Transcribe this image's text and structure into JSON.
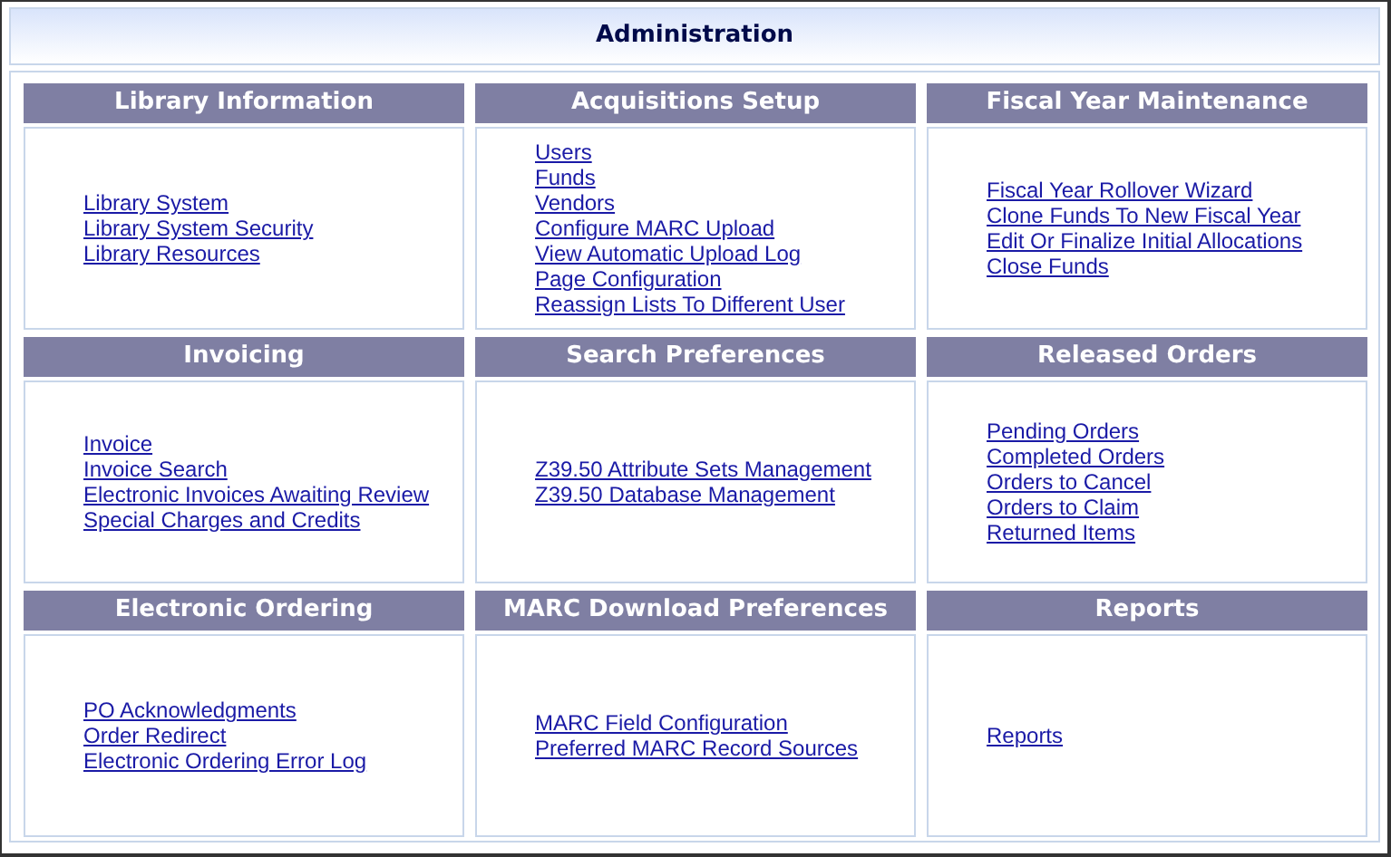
{
  "title": "Administration",
  "panels": [
    {
      "heading": "Library Information",
      "links": [
        "Library System",
        "Library System Security",
        "Library Resources"
      ]
    },
    {
      "heading": "Acquisitions Setup",
      "links": [
        "Users",
        "Funds",
        "Vendors",
        "Configure MARC Upload",
        "View Automatic Upload Log",
        "Page Configuration",
        "Reassign Lists To Different User"
      ]
    },
    {
      "heading": "Fiscal Year Maintenance",
      "links": [
        "Fiscal Year Rollover Wizard",
        "Clone Funds To New Fiscal Year",
        "Edit Or Finalize Initial Allocations",
        "Close Funds"
      ]
    },
    {
      "heading": "Invoicing",
      "links": [
        "Invoice",
        "Invoice Search",
        "Electronic Invoices Awaiting Review",
        "Special Charges and Credits"
      ]
    },
    {
      "heading": "Search Preferences",
      "links": [
        "Z39.50 Attribute Sets Management",
        "Z39.50 Database Management"
      ]
    },
    {
      "heading": "Released Orders",
      "links": [
        "Pending Orders",
        "Completed Orders",
        "Orders to Cancel",
        "Orders to Claim",
        "Returned Items"
      ]
    },
    {
      "heading": "Electronic Ordering",
      "links": [
        "PO Acknowledgments",
        "Order Redirect",
        "Electronic Ordering Error Log"
      ]
    },
    {
      "heading": "MARC Download Preferences",
      "links": [
        "MARC Field Configuration",
        "Preferred MARC Record Sources"
      ]
    },
    {
      "heading": "Reports",
      "links": [
        "Reports"
      ]
    }
  ]
}
